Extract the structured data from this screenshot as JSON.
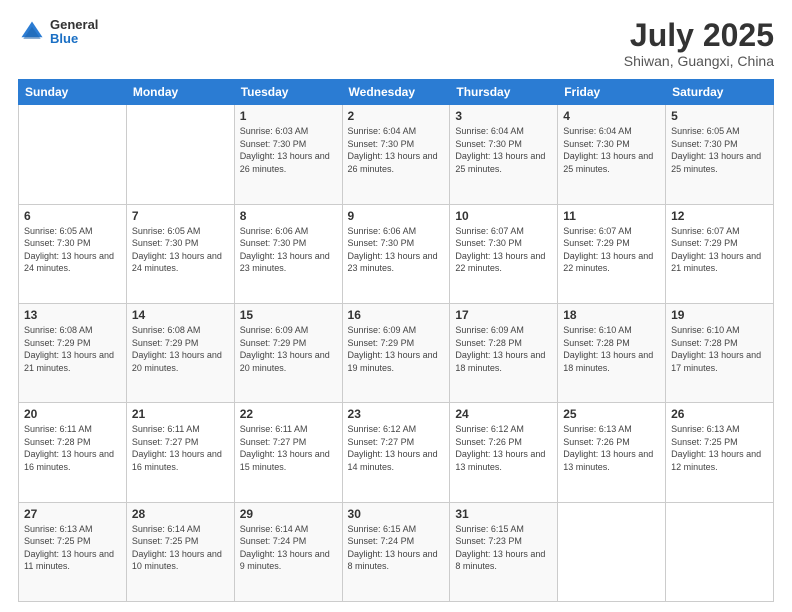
{
  "header": {
    "logo": {
      "general": "General",
      "blue": "Blue"
    },
    "title": "July 2025",
    "location": "Shiwan, Guangxi, China"
  },
  "days_of_week": [
    "Sunday",
    "Monday",
    "Tuesday",
    "Wednesday",
    "Thursday",
    "Friday",
    "Saturday"
  ],
  "weeks": [
    [
      {
        "day": "",
        "sunrise": "",
        "sunset": "",
        "daylight": ""
      },
      {
        "day": "",
        "sunrise": "",
        "sunset": "",
        "daylight": ""
      },
      {
        "day": "1",
        "sunrise": "Sunrise: 6:03 AM",
        "sunset": "Sunset: 7:30 PM",
        "daylight": "Daylight: 13 hours and 26 minutes."
      },
      {
        "day": "2",
        "sunrise": "Sunrise: 6:04 AM",
        "sunset": "Sunset: 7:30 PM",
        "daylight": "Daylight: 13 hours and 26 minutes."
      },
      {
        "day": "3",
        "sunrise": "Sunrise: 6:04 AM",
        "sunset": "Sunset: 7:30 PM",
        "daylight": "Daylight: 13 hours and 25 minutes."
      },
      {
        "day": "4",
        "sunrise": "Sunrise: 6:04 AM",
        "sunset": "Sunset: 7:30 PM",
        "daylight": "Daylight: 13 hours and 25 minutes."
      },
      {
        "day": "5",
        "sunrise": "Sunrise: 6:05 AM",
        "sunset": "Sunset: 7:30 PM",
        "daylight": "Daylight: 13 hours and 25 minutes."
      }
    ],
    [
      {
        "day": "6",
        "sunrise": "Sunrise: 6:05 AM",
        "sunset": "Sunset: 7:30 PM",
        "daylight": "Daylight: 13 hours and 24 minutes."
      },
      {
        "day": "7",
        "sunrise": "Sunrise: 6:05 AM",
        "sunset": "Sunset: 7:30 PM",
        "daylight": "Daylight: 13 hours and 24 minutes."
      },
      {
        "day": "8",
        "sunrise": "Sunrise: 6:06 AM",
        "sunset": "Sunset: 7:30 PM",
        "daylight": "Daylight: 13 hours and 23 minutes."
      },
      {
        "day": "9",
        "sunrise": "Sunrise: 6:06 AM",
        "sunset": "Sunset: 7:30 PM",
        "daylight": "Daylight: 13 hours and 23 minutes."
      },
      {
        "day": "10",
        "sunrise": "Sunrise: 6:07 AM",
        "sunset": "Sunset: 7:30 PM",
        "daylight": "Daylight: 13 hours and 22 minutes."
      },
      {
        "day": "11",
        "sunrise": "Sunrise: 6:07 AM",
        "sunset": "Sunset: 7:29 PM",
        "daylight": "Daylight: 13 hours and 22 minutes."
      },
      {
        "day": "12",
        "sunrise": "Sunrise: 6:07 AM",
        "sunset": "Sunset: 7:29 PM",
        "daylight": "Daylight: 13 hours and 21 minutes."
      }
    ],
    [
      {
        "day": "13",
        "sunrise": "Sunrise: 6:08 AM",
        "sunset": "Sunset: 7:29 PM",
        "daylight": "Daylight: 13 hours and 21 minutes."
      },
      {
        "day": "14",
        "sunrise": "Sunrise: 6:08 AM",
        "sunset": "Sunset: 7:29 PM",
        "daylight": "Daylight: 13 hours and 20 minutes."
      },
      {
        "day": "15",
        "sunrise": "Sunrise: 6:09 AM",
        "sunset": "Sunset: 7:29 PM",
        "daylight": "Daylight: 13 hours and 20 minutes."
      },
      {
        "day": "16",
        "sunrise": "Sunrise: 6:09 AM",
        "sunset": "Sunset: 7:29 PM",
        "daylight": "Daylight: 13 hours and 19 minutes."
      },
      {
        "day": "17",
        "sunrise": "Sunrise: 6:09 AM",
        "sunset": "Sunset: 7:28 PM",
        "daylight": "Daylight: 13 hours and 18 minutes."
      },
      {
        "day": "18",
        "sunrise": "Sunrise: 6:10 AM",
        "sunset": "Sunset: 7:28 PM",
        "daylight": "Daylight: 13 hours and 18 minutes."
      },
      {
        "day": "19",
        "sunrise": "Sunrise: 6:10 AM",
        "sunset": "Sunset: 7:28 PM",
        "daylight": "Daylight: 13 hours and 17 minutes."
      }
    ],
    [
      {
        "day": "20",
        "sunrise": "Sunrise: 6:11 AM",
        "sunset": "Sunset: 7:28 PM",
        "daylight": "Daylight: 13 hours and 16 minutes."
      },
      {
        "day": "21",
        "sunrise": "Sunrise: 6:11 AM",
        "sunset": "Sunset: 7:27 PM",
        "daylight": "Daylight: 13 hours and 16 minutes."
      },
      {
        "day": "22",
        "sunrise": "Sunrise: 6:11 AM",
        "sunset": "Sunset: 7:27 PM",
        "daylight": "Daylight: 13 hours and 15 minutes."
      },
      {
        "day": "23",
        "sunrise": "Sunrise: 6:12 AM",
        "sunset": "Sunset: 7:27 PM",
        "daylight": "Daylight: 13 hours and 14 minutes."
      },
      {
        "day": "24",
        "sunrise": "Sunrise: 6:12 AM",
        "sunset": "Sunset: 7:26 PM",
        "daylight": "Daylight: 13 hours and 13 minutes."
      },
      {
        "day": "25",
        "sunrise": "Sunrise: 6:13 AM",
        "sunset": "Sunset: 7:26 PM",
        "daylight": "Daylight: 13 hours and 13 minutes."
      },
      {
        "day": "26",
        "sunrise": "Sunrise: 6:13 AM",
        "sunset": "Sunset: 7:25 PM",
        "daylight": "Daylight: 13 hours and 12 minutes."
      }
    ],
    [
      {
        "day": "27",
        "sunrise": "Sunrise: 6:13 AM",
        "sunset": "Sunset: 7:25 PM",
        "daylight": "Daylight: 13 hours and 11 minutes."
      },
      {
        "day": "28",
        "sunrise": "Sunrise: 6:14 AM",
        "sunset": "Sunset: 7:25 PM",
        "daylight": "Daylight: 13 hours and 10 minutes."
      },
      {
        "day": "29",
        "sunrise": "Sunrise: 6:14 AM",
        "sunset": "Sunset: 7:24 PM",
        "daylight": "Daylight: 13 hours and 9 minutes."
      },
      {
        "day": "30",
        "sunrise": "Sunrise: 6:15 AM",
        "sunset": "Sunset: 7:24 PM",
        "daylight": "Daylight: 13 hours and 8 minutes."
      },
      {
        "day": "31",
        "sunrise": "Sunrise: 6:15 AM",
        "sunset": "Sunset: 7:23 PM",
        "daylight": "Daylight: 13 hours and 8 minutes."
      },
      {
        "day": "",
        "sunrise": "",
        "sunset": "",
        "daylight": ""
      },
      {
        "day": "",
        "sunrise": "",
        "sunset": "",
        "daylight": ""
      }
    ]
  ]
}
